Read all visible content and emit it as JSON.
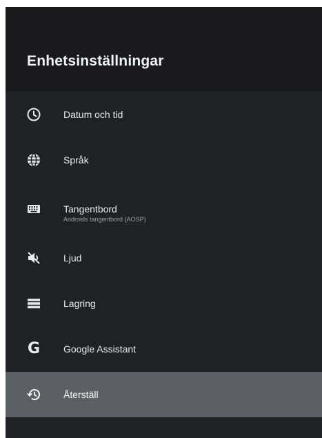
{
  "header": {
    "title": "Enhetsinställningar"
  },
  "menu": {
    "items": [
      {
        "label": "Datum och tid",
        "icon": "clock-icon"
      },
      {
        "label": "Språk",
        "icon": "globe-icon"
      },
      {
        "label": "Tangentbord",
        "sublabel": "Androids tangentbord (AOSP)",
        "icon": "keyboard-icon"
      },
      {
        "label": "Ljud",
        "icon": "volume-off-icon"
      },
      {
        "label": "Lagring",
        "icon": "storage-icon"
      },
      {
        "label": "Google Assistant",
        "icon": "google-icon",
        "glyph": "G"
      },
      {
        "label": "Återställ",
        "icon": "restore-icon",
        "selected": true
      }
    ]
  },
  "colors": {
    "panel_bg": "#202124",
    "header_bg": "#1a1a1c",
    "selected_bg": "#5c5f63",
    "text": "#e8eaed"
  }
}
